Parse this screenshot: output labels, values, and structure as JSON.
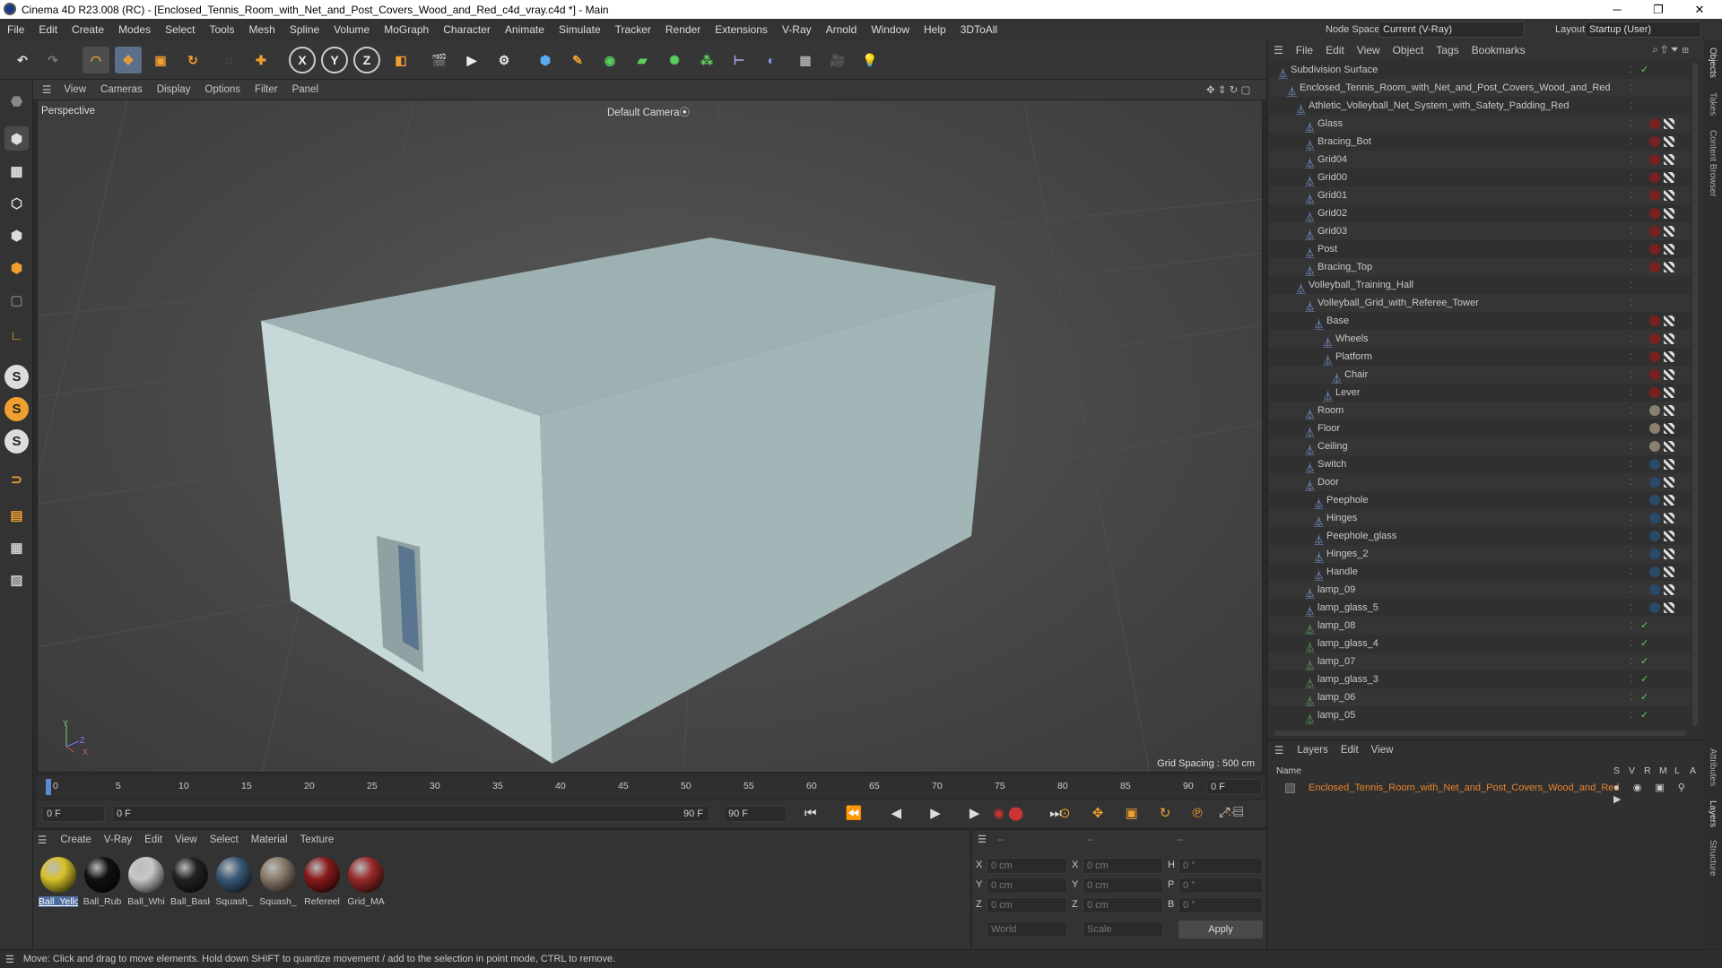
{
  "window": {
    "title": "Cinema 4D R23.008 (RC) - [Enclosed_Tennis_Room_with_Net_and_Post_Covers_Wood_and_Red_c4d_vray.c4d *] - Main",
    "minimize": "─",
    "maximize": "❐",
    "close": "✕"
  },
  "menubar": {
    "items": [
      "File",
      "Edit",
      "Create",
      "Modes",
      "Select",
      "Tools",
      "Mesh",
      "Spline",
      "Volume",
      "MoGraph",
      "Character",
      "Animate",
      "Simulate",
      "Tracker",
      "Render",
      "Extensions",
      "V-Ray",
      "Arnold",
      "Window",
      "Help",
      "3DToAll"
    ],
    "node_space_label": "Node Space:",
    "node_space_value": "Current (V-Ray)",
    "layout_label": "Layout:",
    "layout_value": "Startup (User)"
  },
  "toolbar": {
    "axis_x": "X",
    "axis_y": "Y",
    "axis_z": "Z"
  },
  "lefttools": {
    "s1": "S",
    "s2": "S",
    "s3": "S"
  },
  "viewport": {
    "menu": [
      "View",
      "Cameras",
      "Display",
      "Options",
      "Filter",
      "Panel"
    ],
    "label": "Perspective",
    "camera": "Default Camera",
    "camera_icon": "⦿",
    "grid_spacing": "Grid Spacing : 500 cm",
    "axis_y": "Y",
    "axis_z": "Z",
    "axis_x": "X"
  },
  "timeline": {
    "ticks": [
      "0",
      "5",
      "10",
      "15",
      "20",
      "25",
      "30",
      "35",
      "40",
      "45",
      "50",
      "55",
      "60",
      "65",
      "70",
      "75",
      "80",
      "85",
      "90"
    ],
    "end_frame": "0 F"
  },
  "transport": {
    "start": "0 F",
    "current": "0 F",
    "range_end": "90 F",
    "end": "90 F"
  },
  "materials": {
    "menu": [
      "Create",
      "V-Ray",
      "Edit",
      "View",
      "Select",
      "Material",
      "Texture"
    ],
    "items": [
      {
        "label": "Ball_Yello",
        "color": "#d8c22a"
      },
      {
        "label": "Ball_Rub",
        "color": "#111111"
      },
      {
        "label": "Ball_Whi",
        "color": "#c8c8c8"
      },
      {
        "label": "Ball_Bask",
        "color": "#222222"
      },
      {
        "label": "Squash_",
        "color": "#3a5a78"
      },
      {
        "label": "Squash_",
        "color": "#8a7a6a"
      },
      {
        "label": "Refereel",
        "color": "#8a1a1a"
      },
      {
        "label": "Grid_MA",
        "color": "#9a2a2a"
      }
    ]
  },
  "coords": {
    "header": [
      "--",
      "--",
      "--"
    ],
    "x": "X",
    "y": "Y",
    "z": "Z",
    "x_val": "0 cm",
    "y_val": "0 cm",
    "z_val": "0 cm",
    "x2": "X",
    "y2": "Y",
    "z2": "Z",
    "x2_val": "0 cm",
    "y2_val": "0 cm",
    "z2_val": "0 cm",
    "h": "H",
    "p": "P",
    "b": "B",
    "h_val": "0 °",
    "p_val": "0 °",
    "b_val": "0 °",
    "world": "World",
    "scale": "Scale",
    "apply": "Apply"
  },
  "status": "Move: Click and drag to move elements. Hold down SHIFT to quantize movement / add to the selection in point mode, CTRL to remove.",
  "objects": {
    "menu": [
      "File",
      "Edit",
      "View",
      "Object",
      "Tags",
      "Bookmarks"
    ],
    "rows": [
      {
        "name": "Subdivision Surface",
        "indent": 0,
        "tag": "check"
      },
      {
        "name": "Enclosed_Tennis_Room_with_Net_and_Post_Covers_Wood_and_Red",
        "indent": 1,
        "tag": ""
      },
      {
        "name": "Athletic_Volleyball_Net_System_with_Safety_Padding_Red",
        "indent": 2,
        "tag": ""
      },
      {
        "name": "Glass",
        "indent": 3,
        "tag": "red"
      },
      {
        "name": "Bracing_Bot",
        "indent": 3,
        "tag": "red"
      },
      {
        "name": "Grid04",
        "indent": 3,
        "tag": "red"
      },
      {
        "name": "Grid00",
        "indent": 3,
        "tag": "red"
      },
      {
        "name": "Grid01",
        "indent": 3,
        "tag": "red"
      },
      {
        "name": "Grid02",
        "indent": 3,
        "tag": "red"
      },
      {
        "name": "Grid03",
        "indent": 3,
        "tag": "red"
      },
      {
        "name": "Post",
        "indent": 3,
        "tag": "red"
      },
      {
        "name": "Bracing_Top",
        "indent": 3,
        "tag": "red"
      },
      {
        "name": "Volleyball_Training_Hall",
        "indent": 2,
        "tag": ""
      },
      {
        "name": "Volleyball_Grid_with_Referee_Tower",
        "indent": 3,
        "tag": ""
      },
      {
        "name": "Base",
        "indent": 4,
        "tag": "red"
      },
      {
        "name": "Wheels",
        "indent": 5,
        "tag": "red"
      },
      {
        "name": "Platform",
        "indent": 5,
        "tag": "red"
      },
      {
        "name": "Chair",
        "indent": 6,
        "tag": "red"
      },
      {
        "name": "Lever",
        "indent": 5,
        "tag": "red"
      },
      {
        "name": "Room",
        "indent": 3,
        "tag": "grey"
      },
      {
        "name": "Floor",
        "indent": 3,
        "tag": "grey"
      },
      {
        "name": "Ceiling",
        "indent": 3,
        "tag": "grey"
      },
      {
        "name": "Switch",
        "indent": 3,
        "tag": "blue"
      },
      {
        "name": "Door",
        "indent": 3,
        "tag": "blue"
      },
      {
        "name": "Peephole",
        "indent": 4,
        "tag": "blue"
      },
      {
        "name": "Hinges",
        "indent": 4,
        "tag": "blue"
      },
      {
        "name": "Peephole_glass",
        "indent": 4,
        "tag": "blue"
      },
      {
        "name": "Hinges_2",
        "indent": 4,
        "tag": "blue"
      },
      {
        "name": "Handle",
        "indent": 4,
        "tag": "blue"
      },
      {
        "name": "lamp_09",
        "indent": 3,
        "tag": "blue"
      },
      {
        "name": "lamp_glass_5",
        "indent": 3,
        "tag": "blue"
      },
      {
        "name": "lamp_08",
        "indent": 3,
        "tag": "check"
      },
      {
        "name": "lamp_glass_4",
        "indent": 3,
        "tag": "check"
      },
      {
        "name": "lamp_07",
        "indent": 3,
        "tag": "check"
      },
      {
        "name": "lamp_glass_3",
        "indent": 3,
        "tag": "check"
      },
      {
        "name": "lamp_06",
        "indent": 3,
        "tag": "check"
      },
      {
        "name": "lamp_05",
        "indent": 3,
        "tag": "check"
      }
    ]
  },
  "layers": {
    "menu": [
      "Layers",
      "Edit",
      "View"
    ],
    "name_col": "Name",
    "cols": [
      "S",
      "V",
      "R",
      "M",
      "L",
      "A"
    ],
    "row": "Enclosed_Tennis_Room_with_Net_and_Post_Covers_Wood_and_Red"
  },
  "rightstrip": [
    "Objects",
    "Takes",
    "Content Browser",
    "Attributes",
    "Layers",
    "Structure"
  ]
}
